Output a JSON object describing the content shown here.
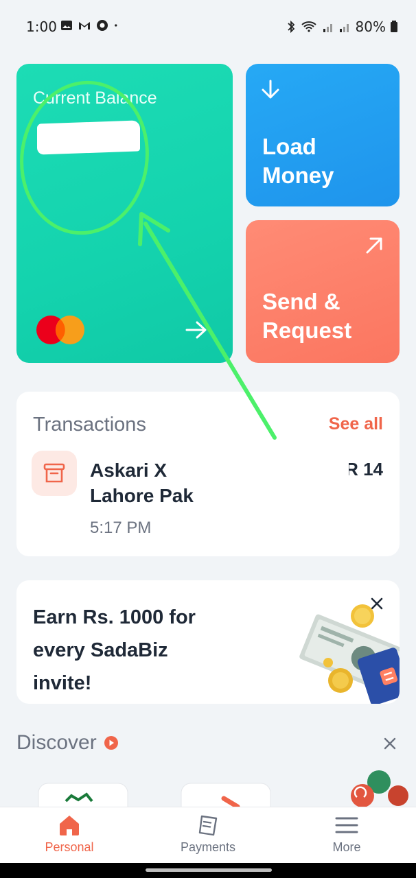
{
  "status_bar": {
    "time": "1:00",
    "battery": "80%"
  },
  "balance_card": {
    "label": "Current Balance",
    "value": "",
    "card_brand_icon": "mastercard-logo",
    "arrow_icon": "arrow-right-icon",
    "color": "#1ddcb5"
  },
  "load_money": {
    "title_line1": "Load",
    "title_line2": "Money",
    "icon": "arrow-down-icon",
    "color": "#26a9f5"
  },
  "send_request": {
    "title_line1": "Send &",
    "title_line2": "Request",
    "icon": "arrow-up-right-icon",
    "color": "#fb7660"
  },
  "transactions": {
    "title": "Transactions",
    "see_all": "See all",
    "items": [
      {
        "name_line1": "Askari X",
        "name_line2": "Lahore Pak",
        "time": "5:17 PM",
        "amount": "R              14",
        "icon": "shop-icon"
      }
    ]
  },
  "promo": {
    "line1": "Earn Rs. 1000 for",
    "line2": "every SadaBiz",
    "line3": "invite!",
    "close_icon": "close-icon"
  },
  "discover": {
    "title": "Discover",
    "icon": "play-icon"
  },
  "bottom_nav": {
    "items": [
      {
        "label": "Personal",
        "icon": "home-icon",
        "active": true
      },
      {
        "label": "Payments",
        "icon": "receipt-icon",
        "active": false
      },
      {
        "label": "More",
        "icon": "menu-icon",
        "active": false
      }
    ]
  },
  "colors": {
    "accent": "#f0654a",
    "background": "#f1f4f7",
    "annotation": "#4cf06a"
  }
}
